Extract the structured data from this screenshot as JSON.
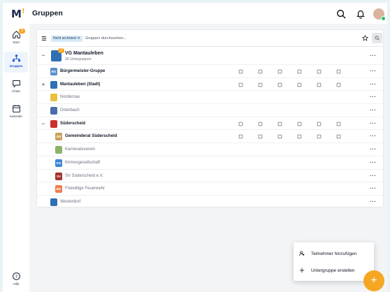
{
  "app": {
    "logo_text": "M",
    "logo_accent": "!",
    "title": "Gruppen",
    "icons": [
      "search-icon",
      "bell-icon",
      "user-avatar"
    ]
  },
  "sidebar": {
    "items": [
      {
        "label": "Start",
        "icon": "home-icon",
        "badge": "2",
        "active": false
      },
      {
        "label": "Gruppen",
        "icon": "groups-icon",
        "active": true
      },
      {
        "label": "Chats",
        "icon": "chat-icon",
        "active": false
      },
      {
        "label": "Kalender",
        "icon": "calendar-icon",
        "active": false
      }
    ],
    "help_label": "Hilfe"
  },
  "filter": {
    "chip_label": "Nicht archiviert",
    "search_placeholder": "Gruppen durchsuchen..."
  },
  "top_group": {
    "name": "VG Mantauleben",
    "subtitle": "36 Untergruppen",
    "badge": "2"
  },
  "rows": [
    {
      "name": "Bürgermeister-Gruppe",
      "initials": "BG",
      "color": "#5b8fc7",
      "indent": 1,
      "toggle": "",
      "bold": true,
      "icons": true
    },
    {
      "name": "Mantauleben (Stadt)",
      "initials": "",
      "color": "#2f6fb3",
      "indent": 1,
      "toggle": "+",
      "bold": true,
      "icons": true
    },
    {
      "name": "Nordernau",
      "initials": "",
      "color": "#e8c13a",
      "indent": 1,
      "toggle": "",
      "bold": false,
      "icons": false
    },
    {
      "name": "Osterbach",
      "initials": "",
      "color": "#4a6fa8",
      "indent": 1,
      "toggle": "",
      "bold": false,
      "icons": false
    },
    {
      "name": "Süderscheid",
      "initials": "",
      "color": "#c8312f",
      "indent": 1,
      "toggle": "−",
      "bold": true,
      "icons": true
    },
    {
      "name": "Gemeinderat Süderscheid",
      "initials": "GR",
      "color": "#c9a15a",
      "indent": 2,
      "toggle": "",
      "bold": true,
      "icons": true
    },
    {
      "name": "Karnevalsverein",
      "initials": "",
      "color": "#8db36a",
      "indent": 2,
      "toggle": "",
      "bold": false,
      "icons": false
    },
    {
      "name": "Kirmesgesellschaft",
      "initials": "KG",
      "color": "#3b87d8",
      "indent": 2,
      "toggle": "",
      "bold": false,
      "icons": false
    },
    {
      "name": "SV Süderscheid e.V.",
      "initials": "SV",
      "color": "#a3322e",
      "indent": 2,
      "toggle": "",
      "bold": false,
      "icons": false
    },
    {
      "name": "Freiwillige Feuerwehr",
      "initials": "BG",
      "color": "#f07b4f",
      "indent": 2,
      "toggle": "",
      "bold": false,
      "icons": false
    },
    {
      "name": "Westerdorf",
      "initials": "",
      "color": "#2f6fb3",
      "indent": 1,
      "toggle": "",
      "bold": false,
      "icons": false
    }
  ],
  "popup": {
    "add_participant": "Teilnehmer hinzufügen",
    "create_subgroup": "Untergruppe erstellen"
  },
  "colors": {
    "accent": "#f5a623",
    "primary": "#1d4ed8"
  }
}
